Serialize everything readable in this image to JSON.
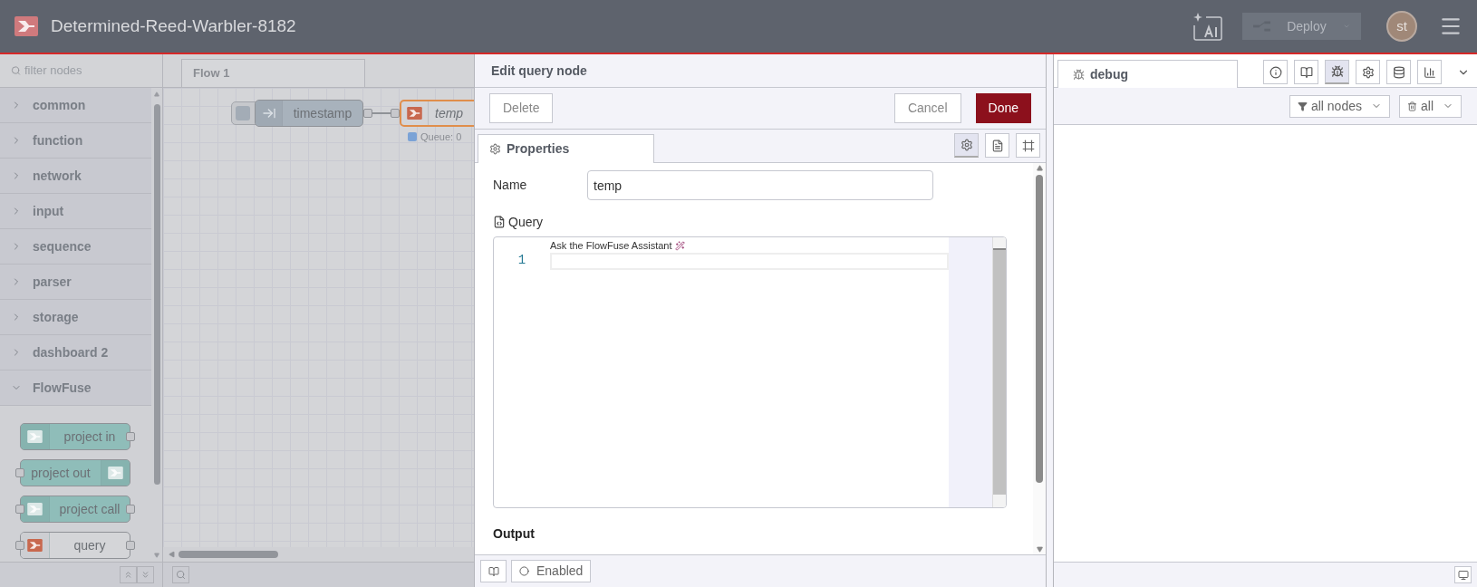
{
  "header": {
    "title": "Determined-Reed-Warbler-8182",
    "deploy": "Deploy",
    "avatar": "st"
  },
  "palette": {
    "filter_placeholder": "filter nodes",
    "categories": [
      {
        "label": "common",
        "expanded": false
      },
      {
        "label": "function",
        "expanded": false
      },
      {
        "label": "network",
        "expanded": false
      },
      {
        "label": "input",
        "expanded": false
      },
      {
        "label": "sequence",
        "expanded": false
      },
      {
        "label": "parser",
        "expanded": false
      },
      {
        "label": "storage",
        "expanded": false
      },
      {
        "label": "dashboard 2",
        "expanded": false
      },
      {
        "label": "FlowFuse",
        "expanded": true,
        "nodes": [
          {
            "label": "project in",
            "kind": "in"
          },
          {
            "label": "project out",
            "kind": "out"
          },
          {
            "label": "project call",
            "kind": "call"
          },
          {
            "label": "query",
            "kind": "query"
          }
        ]
      }
    ]
  },
  "workspace": {
    "tabs": [
      {
        "label": "Flow 1",
        "selected": true
      }
    ],
    "nodes": [
      {
        "label": "timestamp",
        "kind": "inject"
      },
      {
        "label": "temp",
        "kind": "query",
        "status": "Queue: 0"
      }
    ]
  },
  "editor": {
    "title": "Edit query node",
    "delete": "Delete",
    "cancel": "Cancel",
    "done": "Done",
    "tabs": [
      {
        "label": "Properties",
        "selected": true
      }
    ],
    "icon_tabs": [
      {
        "kind": "settings",
        "selected": true
      },
      {
        "kind": "description",
        "selected": false
      },
      {
        "kind": "appearance",
        "selected": false
      }
    ],
    "name_label": "Name",
    "name_value": "temp",
    "query_label": "Query",
    "assistant_hint": "Ask the FlowFuse Assistant",
    "line_numbers": [
      "1"
    ],
    "output_label": "Output",
    "enabled_label": "Enabled"
  },
  "sidebar": {
    "tabs": [
      {
        "label": "debug",
        "selected": true
      }
    ],
    "icon_tabs": [
      {
        "kind": "info",
        "selected": false
      },
      {
        "kind": "help",
        "selected": false
      },
      {
        "kind": "debug",
        "selected": true
      },
      {
        "kind": "config",
        "selected": false
      },
      {
        "kind": "context",
        "selected": false
      },
      {
        "kind": "dashboard",
        "selected": false
      }
    ],
    "filter": "all nodes",
    "clear": "all"
  }
}
